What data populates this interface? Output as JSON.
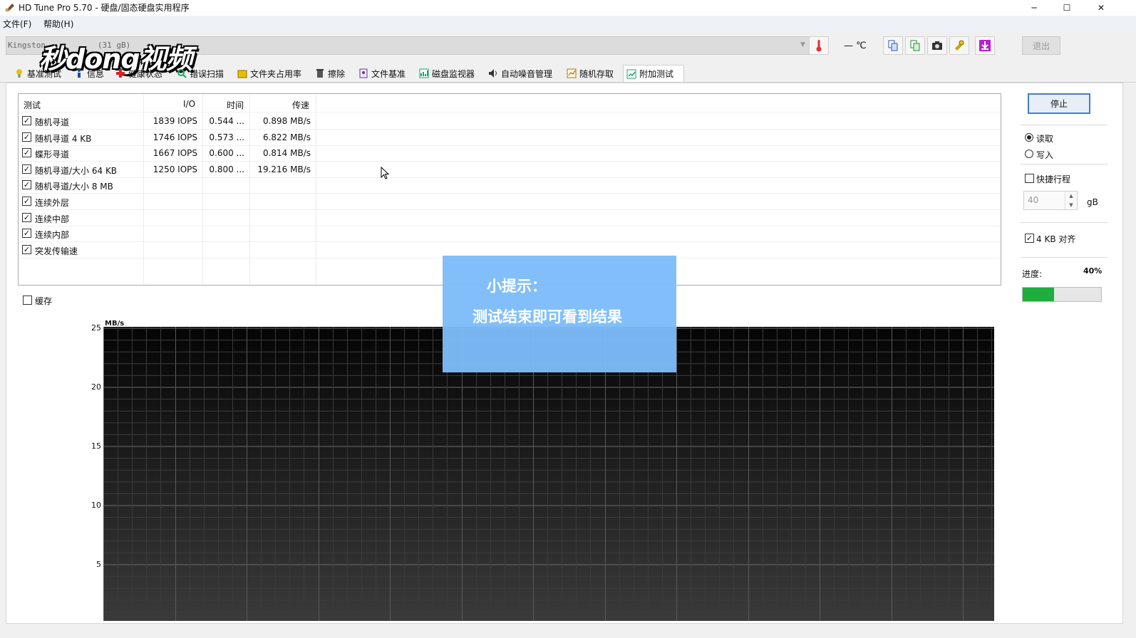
{
  "window": {
    "title": "HD Tune Pro 5.70 - 硬盘/固态硬盘实用程序",
    "minimize_glyph": "─",
    "maximize_glyph": "☐",
    "close_glyph": "✕"
  },
  "menu": [
    "文件(F)",
    "帮助(H)"
  ],
  "drive": {
    "name": "Kingston",
    "size_fragment": "(31 gB)"
  },
  "temperature": "— ℃",
  "toolbar": {
    "exit_label": "退出",
    "icons": [
      "copy-info-icon",
      "copy-results-icon",
      "screenshot-icon",
      "options-icon",
      "save-icon"
    ]
  },
  "watermark": "秒dong视频",
  "tabs": [
    {
      "label": "基准测试",
      "icon": "benchmark-icon"
    },
    {
      "label": "信息",
      "icon": "info-icon"
    },
    {
      "label": "健康状态",
      "icon": "health-icon"
    },
    {
      "label": "错误扫描",
      "icon": "error-scan-icon"
    },
    {
      "label": "文件夹占用率",
      "icon": "folder-icon"
    },
    {
      "label": "擦除",
      "icon": "erase-icon"
    },
    {
      "label": "文件基准",
      "icon": "file-benchmark-icon"
    },
    {
      "label": "磁盘监视器",
      "icon": "disk-monitor-icon"
    },
    {
      "label": "自动噪音管理",
      "icon": "speaker-icon"
    },
    {
      "label": "随机存取",
      "icon": "random-access-icon"
    },
    {
      "label": "附加测试",
      "icon": "extra-tests-icon",
      "active": true
    }
  ],
  "table": {
    "headers": [
      "测试",
      "I/O",
      "时间",
      "传速"
    ],
    "rows": [
      {
        "test": "随机寻道",
        "io": "1839 IOPS",
        "time": "0.544 ...",
        "rate": "0.898 MB/s",
        "checked": true
      },
      {
        "test": "随机寻道 4 KB",
        "io": "1746 IOPS",
        "time": "0.573 ...",
        "rate": "6.822 MB/s",
        "checked": true
      },
      {
        "test": "蝶形寻道",
        "io": "1667 IOPS",
        "time": "0.600 ...",
        "rate": "0.814 MB/s",
        "checked": true
      },
      {
        "test": "随机寻道/大小 64 KB",
        "io": "1250 IOPS",
        "time": "0.800 ...",
        "rate": "19.216 MB/s",
        "checked": true
      },
      {
        "test": "随机寻道/大小 8 MB",
        "io": "",
        "time": "",
        "rate": "",
        "checked": true
      },
      {
        "test": "连续外层",
        "io": "",
        "time": "",
        "rate": "",
        "checked": true
      },
      {
        "test": "连续中部",
        "io": "",
        "time": "",
        "rate": "",
        "checked": true
      },
      {
        "test": "连续内部",
        "io": "",
        "time": "",
        "rate": "",
        "checked": true
      },
      {
        "test": "突发传输速",
        "io": "",
        "time": "",
        "rate": "",
        "checked": true
      }
    ]
  },
  "cache": {
    "label": "缓存",
    "checked": false
  },
  "chart": {
    "unit": "MB/s",
    "y_ticks": [
      "25",
      "20",
      "15",
      "10",
      "5"
    ]
  },
  "chart_data": {
    "type": "line",
    "ylabel": "MB/s",
    "ylim": [
      0,
      25
    ],
    "series": [],
    "grid": true
  },
  "tooltip": {
    "title": "小提示：",
    "body": "测试结束即可看到结果"
  },
  "controls": {
    "stop_label": "停止",
    "read_label": "读取",
    "write_label": "写入",
    "mode_selected": "read",
    "short_stroke_label": "快捷行程",
    "short_stroke_checked": false,
    "short_stroke_value": "40",
    "short_stroke_unit": "gB",
    "align_label": "4 KB 对齐",
    "align_checked": true,
    "spin_up": "▲",
    "spin_down": "▼",
    "progress_label": "进度:",
    "progress_text": "40%",
    "progress_fraction": 0.4,
    "progress_color": "#1fae3d"
  }
}
